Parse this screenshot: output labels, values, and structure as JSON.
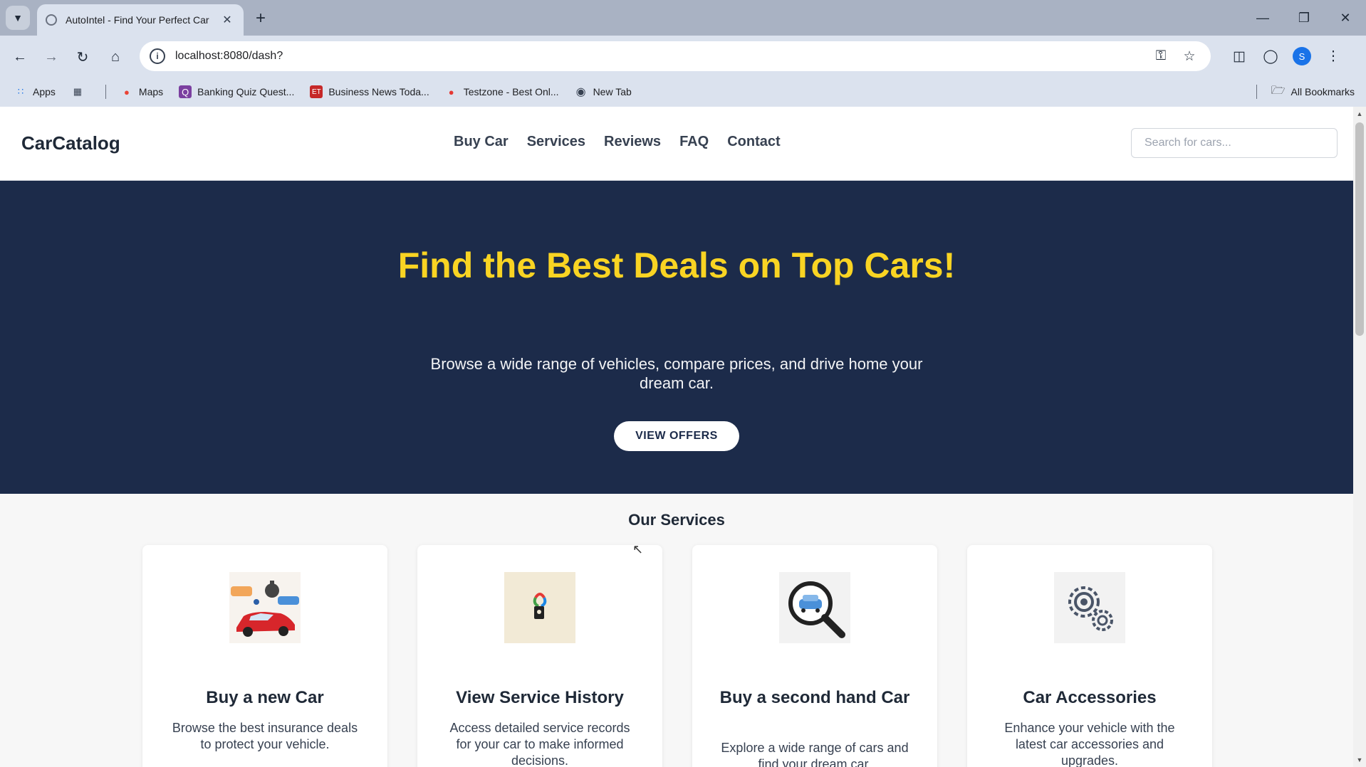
{
  "browser": {
    "tab_title": "AutoIntel - Find Your Perfect Car",
    "url": "localhost:8080/dash?",
    "profile_initial": "S",
    "icons": {
      "tab_search": "chevron-down-icon",
      "new_tab": "plus-icon",
      "back": "arrow-left-icon",
      "forward": "arrow-right-icon",
      "reload": "reload-icon",
      "home": "home-icon",
      "site_info": "info-icon",
      "password": "key-icon",
      "bookmark_star": "star-icon",
      "extensions": "puzzle-icon",
      "menu": "kebab-menu-icon"
    },
    "bookmarks": [
      {
        "label": "Apps",
        "icon": "apps-grid-icon"
      },
      {
        "label": "",
        "icon": "grid-icon"
      },
      {
        "label": "Maps",
        "icon": "map-pin-icon"
      },
      {
        "label": "Banking Quiz Quest...",
        "icon": "quiz-icon"
      },
      {
        "label": "Business News Toda...",
        "icon": "news-icon"
      },
      {
        "label": "Testzone - Best Onl...",
        "icon": "pin-icon"
      },
      {
        "label": "New Tab",
        "icon": "globe-icon"
      }
    ],
    "all_bookmarks": "All Bookmarks"
  },
  "site": {
    "brand": "CarCatalog",
    "nav": [
      "Buy Car",
      "Services",
      "Reviews",
      "FAQ",
      "Contact"
    ],
    "search_placeholder": "Search for cars..."
  },
  "hero": {
    "title": "Find the Best Deals on Top Cars!",
    "subtitle": "Browse a wide range of vehicles, compare prices, and drive home your dream car.",
    "button": "VIEW OFFERS"
  },
  "services": {
    "title": "Our Services",
    "cards": [
      {
        "title": "Buy a new Car",
        "text": "Browse the best insurance deals to protect your vehicle.",
        "icon": "red-car-deal-icon"
      },
      {
        "title": "View Service History",
        "text": "Access detailed service records for your car to make informed decisions.",
        "icon": "service-tag-icon"
      },
      {
        "title": "Buy a second hand Car",
        "text": "Explore a wide range of cars and find your dream car.",
        "icon": "car-magnifier-icon"
      },
      {
        "title": "Car Accessories",
        "text": "Enhance your vehicle with the latest car accessories and upgrades.",
        "icon": "gears-icon"
      }
    ]
  },
  "colors": {
    "hero_bg": "#1c2b4a",
    "hero_title": "#f9d423",
    "page_bg": "#f7f7f7"
  }
}
